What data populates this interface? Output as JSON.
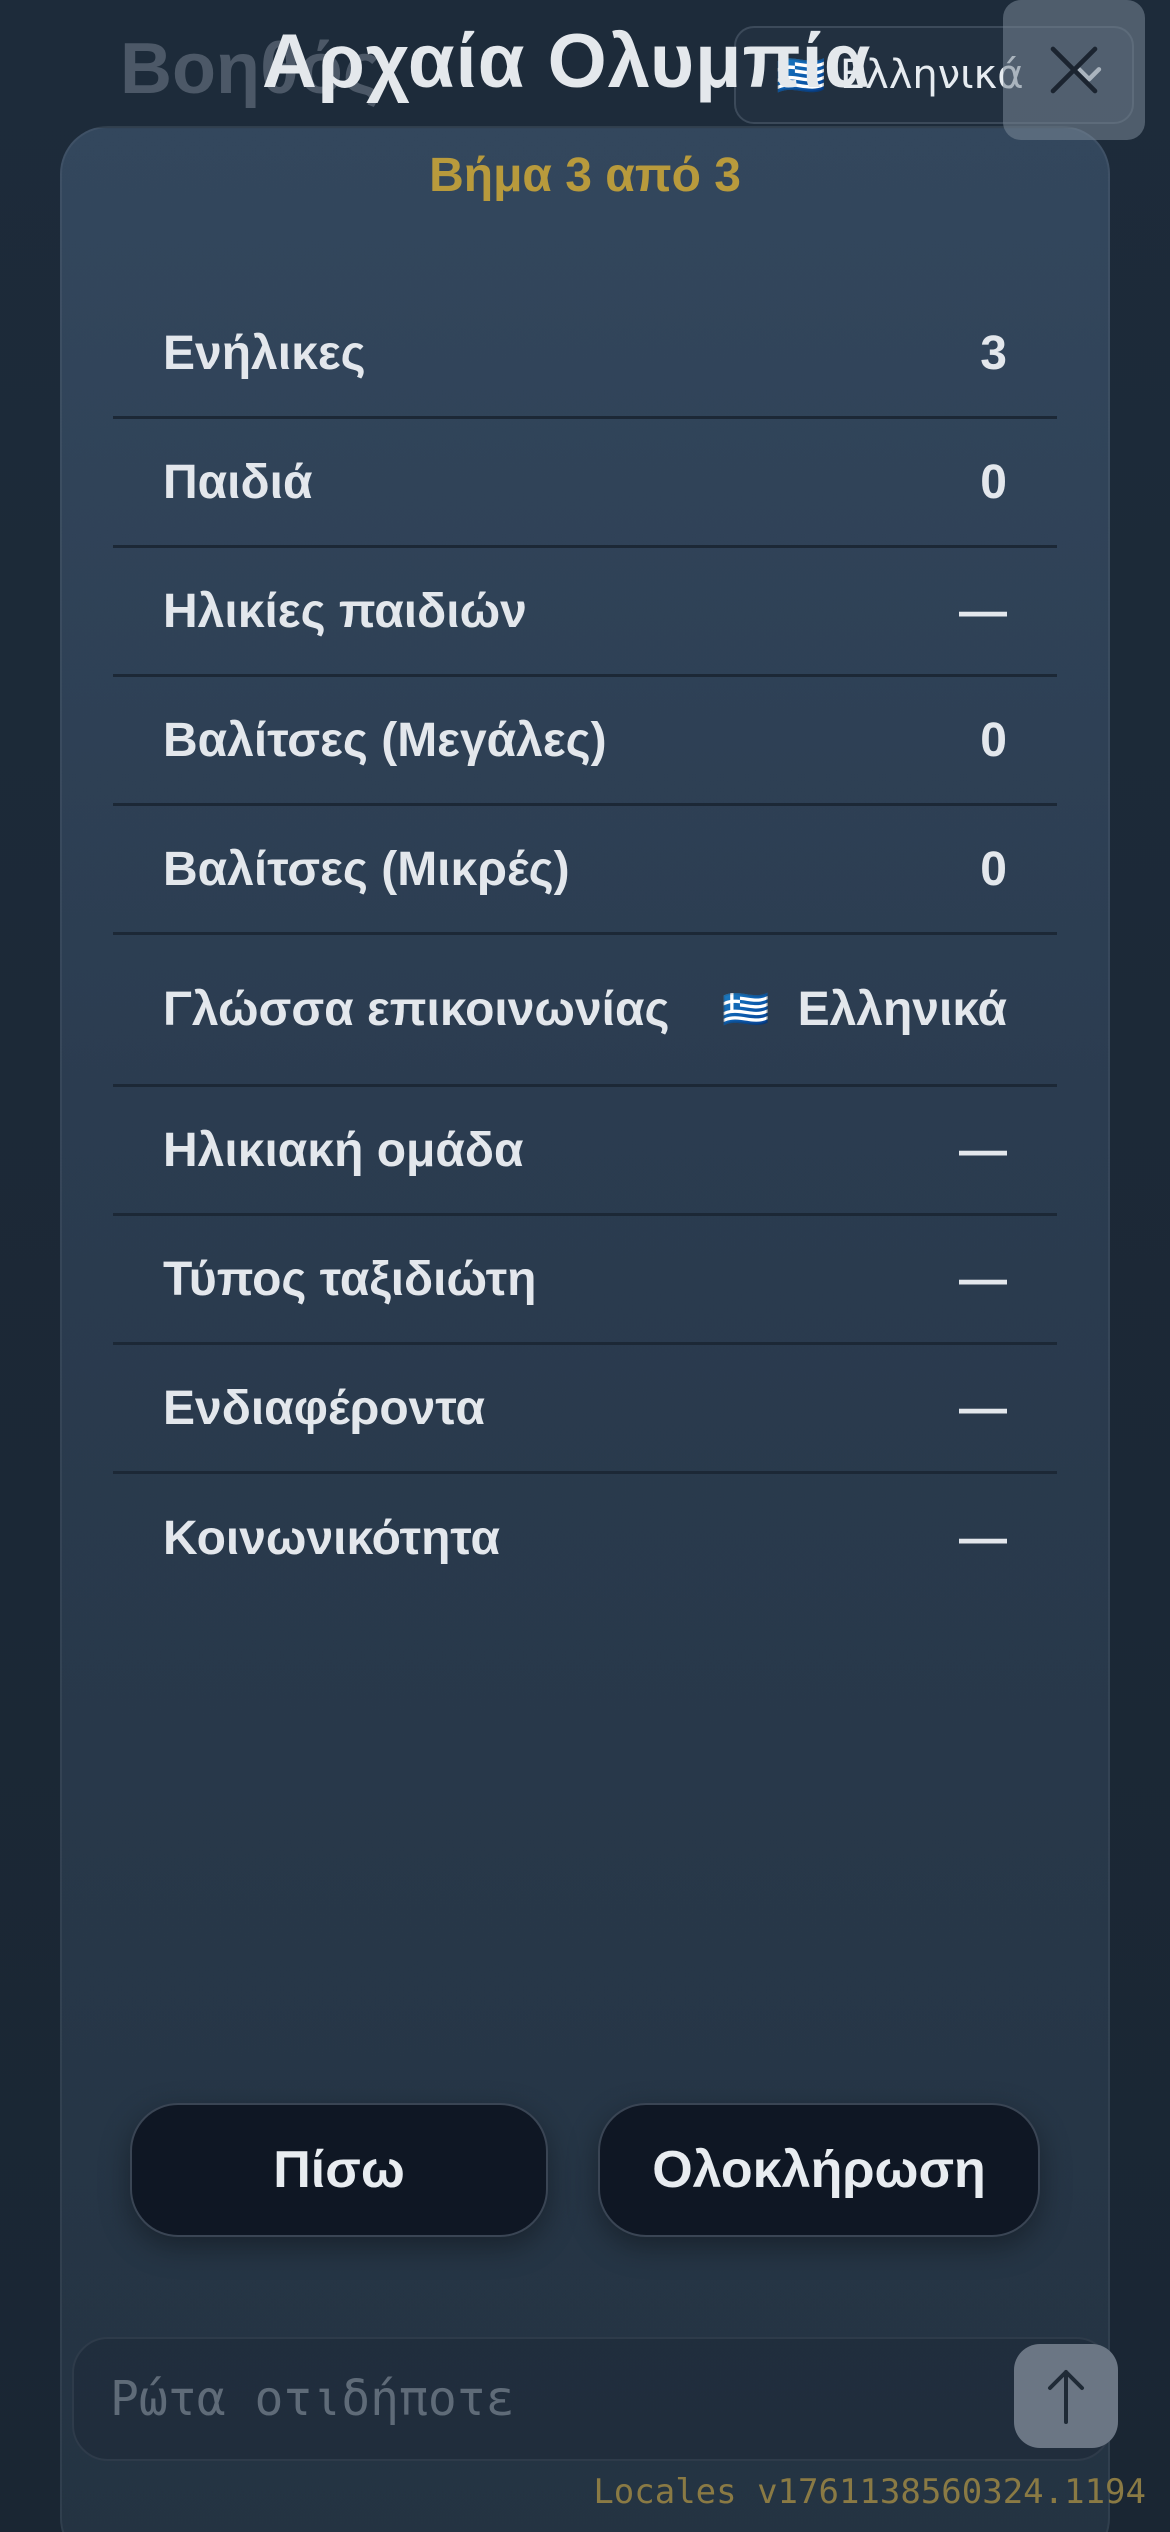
{
  "header": {
    "background_title": "Βοηθός",
    "title": "Αρχαία Ολυμπία",
    "language": {
      "flag": "🇬🇷",
      "label": "Ελληνικά"
    }
  },
  "modal": {
    "step": "Βήμα 3 από 3",
    "rows": [
      {
        "label": "Ενήλικες",
        "value": "3"
      },
      {
        "label": "Παιδιά",
        "value": "0"
      },
      {
        "label": "Ηλικίες παιδιών",
        "value": "—"
      },
      {
        "label": "Βαλίτσες (Μεγάλες)",
        "value": "0"
      },
      {
        "label": "Βαλίτσες (Μικρές)",
        "value": "0"
      },
      {
        "label": "Γλώσσα επικοινωνίας",
        "flag": "🇬🇷",
        "value": "Ελληνικά"
      },
      {
        "label": "Ηλικιακή ομάδα",
        "value": "—"
      },
      {
        "label": "Τύπος ταξιδιώτη",
        "value": "—"
      },
      {
        "label": "Ενδιαφέροντα",
        "value": "—"
      },
      {
        "label": "Κοινωνικότητα",
        "value": "—"
      }
    ],
    "back_label": "Πίσω",
    "finish_label": "Ολοκλήρωση"
  },
  "chat": {
    "placeholder": "Ρώτα οτιδήποτε"
  },
  "footer": {
    "version": "Locales v1761138560324.1194"
  },
  "colors": {
    "accent": "#b89a3c",
    "card": "#2f4256",
    "background": "#1a2634"
  },
  "icons": {
    "close": "close-icon",
    "chevron": "chevron-down-icon",
    "send": "arrow-up-icon"
  }
}
